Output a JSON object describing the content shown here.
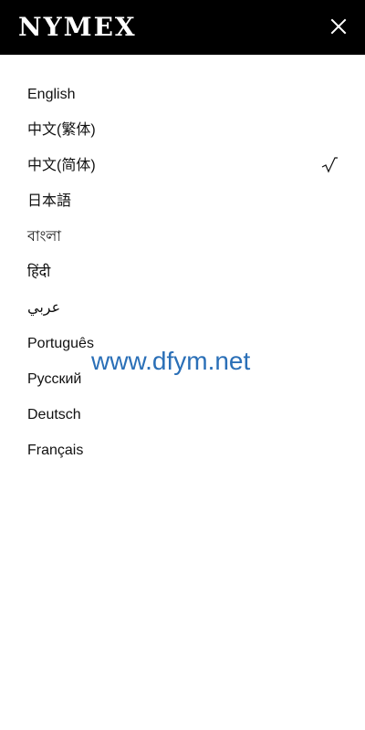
{
  "header": {
    "brand": "NYMEX",
    "close_icon": "close-icon"
  },
  "languages": [
    {
      "label": "English"
    },
    {
      "label": "中文(繁体)"
    },
    {
      "label": "中文(简体)",
      "selected": true
    },
    {
      "label": "日本語"
    },
    {
      "label": "বাংলা"
    },
    {
      "label": "हिंदी"
    },
    {
      "label": "عربي"
    },
    {
      "label": "Português"
    },
    {
      "label": "Русский"
    },
    {
      "label": "Deutsch"
    },
    {
      "label": "Français"
    }
  ],
  "selected_icon": "checkmark-icon",
  "watermark": "www.dfym.net"
}
